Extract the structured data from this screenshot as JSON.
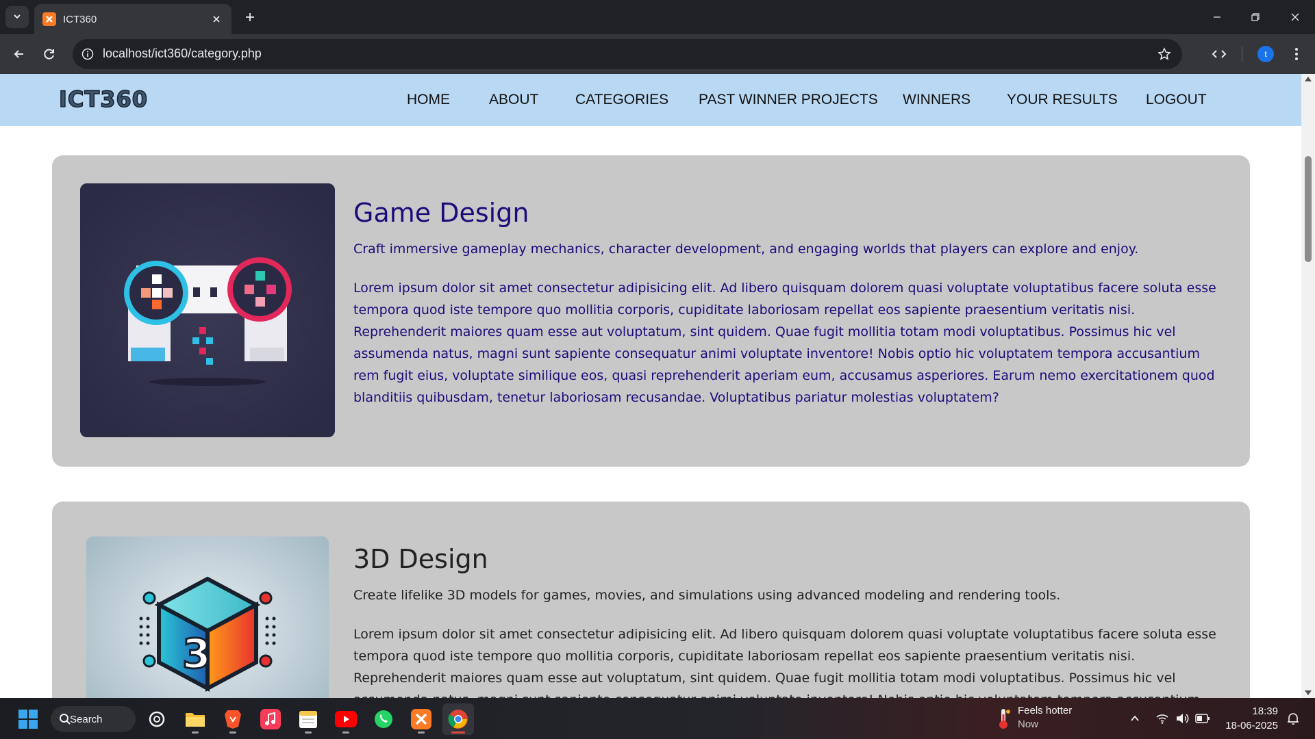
{
  "browser": {
    "tab_title": "ICT360",
    "url": "localhost/ict360/category.php",
    "profile_initial": "t"
  },
  "site": {
    "logo_text": "ICT360",
    "nav": [
      {
        "label": "HOME"
      },
      {
        "label": "ABOUT"
      },
      {
        "label": "CATEGORIES"
      },
      {
        "label": "PAST WINNER PROJECTS"
      },
      {
        "label": "WINNERS"
      },
      {
        "label": "YOUR RESULTS"
      },
      {
        "label": "LOGOUT"
      }
    ],
    "header_color": "#b9d8f3"
  },
  "categories": [
    {
      "title": "Game Design",
      "summary": "Craft immersive gameplay mechanics, character development, and engaging worlds that players can explore and enjoy.",
      "body": "Lorem ipsum dolor sit amet consectetur adipisicing elit. Ad libero quisquam dolorem quasi voluptate voluptatibus facere soluta esse tempora quod iste tempore quo mollitia corporis, cupiditate laboriosam repellat eos sapiente praesentium veritatis nisi. Reprehenderit maiores quam esse aut voluptatum, sint quidem. Quae fugit mollitia totam modi voluptatibus. Possimus hic vel assumenda natus, magni sunt sapiente consequatur animi voluptate inventore! Nobis optio hic voluptatem tempora accusantium rem fugit eius, voluptate similique eos, quasi reprehenderit aperiam eum, accusamus asperiores. Earum nemo exercitationem quod blanditiis quibusdam, tenetur laboriosam recusandae. Voluptatibus pariatur molestias voluptatem?",
      "text_color": "#1f0a7a",
      "image": "gamepad-illustration"
    },
    {
      "title": "3D Design",
      "summary": "Create lifelike 3D models for games, movies, and simulations using advanced modeling and rendering tools.",
      "body": "Lorem ipsum dolor sit amet consectetur adipisicing elit. Ad libero quisquam dolorem quasi voluptate voluptatibus facere soluta esse tempora quod iste tempore quo mollitia corporis, cupiditate laboriosam repellat eos sapiente praesentium veritatis nisi. Reprehenderit maiores quam esse aut voluptatum, sint quidem. Quae fugit mollitia totam modi voluptatibus. Possimus hic vel assumenda natus, magni sunt sapiente consequatur animi voluptate inventore! Nobis optio hic voluptatem tempora accusantium rem fugit eius, voluptate similique eos, quasi",
      "text_color": "#222222",
      "image": "3d-cube-illustration"
    }
  ],
  "taskbar": {
    "search_label": "Search",
    "weather_title": "Feels hotter",
    "weather_sub": "Now",
    "time": "18:39",
    "date": "18-06-2025"
  }
}
